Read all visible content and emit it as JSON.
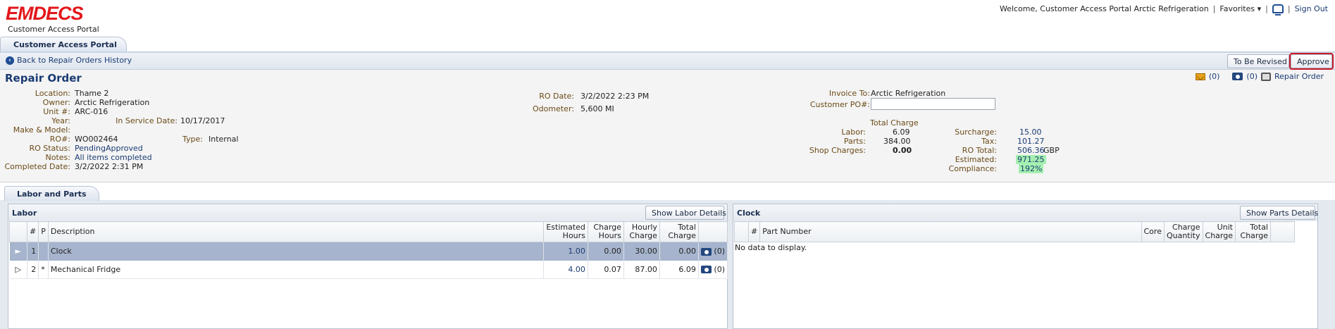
{
  "brand": {
    "logo_text": "EMDECS",
    "subtitle": "Customer Access Portal"
  },
  "header": {
    "welcome": "Welcome, Customer Access Portal Arctic Refrigeration",
    "favorites": "Favorites",
    "favorites_caret": "▾",
    "sep": "|",
    "sign_out": "Sign Out"
  },
  "main_tab": "Customer Access Portal",
  "toolbar": {
    "back": "Back to Repair Orders History",
    "to_be_revised": "To Be Revised",
    "approve": "Approve"
  },
  "repair_order": {
    "title": "Repair Order",
    "icons": {
      "messages_count": "(0)",
      "photos_count": "(0)",
      "print_label": "Repair Order"
    },
    "labels": {
      "location": "Location:",
      "owner": "Owner:",
      "unit": "Unit #:",
      "year": "Year:",
      "in_service_date": "In Service Date:",
      "make_model": "Make & Model:",
      "ro_num": "RO#:",
      "type": "Type:",
      "ro_status": "RO Status:",
      "notes": "Notes:",
      "completed_date": "Completed Date:",
      "ro_date": "RO Date:",
      "odometer": "Odometer:",
      "invoice_to": "Invoice To:",
      "customer_po": "Customer PO#:"
    },
    "values": {
      "location": "Thame 2",
      "owner": "Arctic Refrigeration",
      "unit": "ARC-016",
      "year": "",
      "in_service_date": "10/17/2017",
      "make_model": "",
      "ro_num": "WO002464",
      "type": "Internal",
      "ro_status": "PendingApproved",
      "notes": "All items completed",
      "completed_date": "3/2/2022 2:31 PM",
      "ro_date": "3/2/2022 2:23 PM",
      "odometer": "5,600 MI",
      "invoice_to": "Arctic Refrigeration",
      "customer_po": ""
    },
    "totals": {
      "heading": "Total Charge",
      "labor_label": "Labor:",
      "labor": "6.09",
      "parts_label": "Parts:",
      "parts": "384.00",
      "shop_label": "Shop Charges:",
      "shop": "0.00",
      "surcharge_label": "Surcharge:",
      "surcharge": "15.00",
      "tax_label": "Tax:",
      "tax": "101.27",
      "ro_total_label": "RO Total:",
      "ro_total": "506.36",
      "currency": "GBP",
      "estimated_label": "Estimated:",
      "estimated": "971.25",
      "compliance_label": "Compliance:",
      "compliance": "192%"
    }
  },
  "labor_parts_tab": "Labor and Parts",
  "labor": {
    "title": "Labor",
    "details_button": "Show Labor Details",
    "columns": [
      "",
      "#",
      "P",
      "Description",
      "Estimated Hours",
      "Charge Hours",
      "Hourly Charge",
      "Total Charge",
      ""
    ],
    "rows": [
      {
        "arrow": "►",
        "num": "1",
        "p": "",
        "desc": "Clock",
        "est": "1.00",
        "charge": "0.00",
        "hourly": "30.00",
        "total": "0.00",
        "photos": "(0)"
      },
      {
        "arrow": "▷",
        "num": "2",
        "p": "*",
        "desc": "Mechanical Fridge",
        "est": "4.00",
        "charge": "0.07",
        "hourly": "87.00",
        "total": "6.09",
        "photos": "(0)"
      }
    ]
  },
  "clock": {
    "title": "Clock",
    "details_button": "Show Parts Details",
    "columns": [
      "",
      "#",
      "Part Number",
      "Core",
      "Charge Quantity",
      "Unit Charge",
      "Total Charge",
      ""
    ],
    "empty": "No data to display."
  }
}
